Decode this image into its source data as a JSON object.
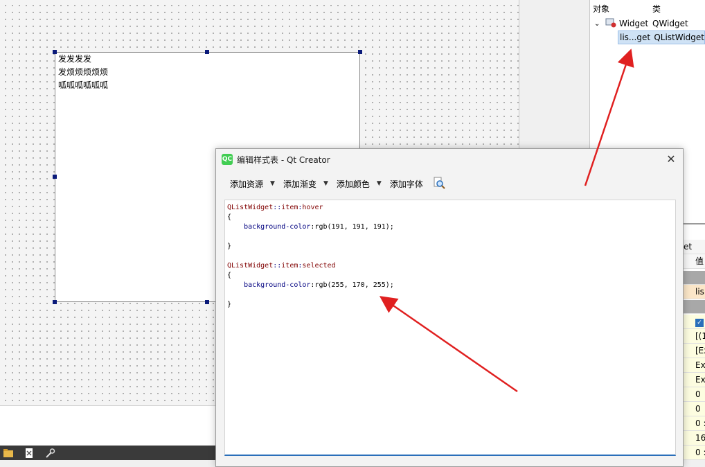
{
  "designer": {
    "list_items": [
      "发发发发",
      "发烦烦烦烦烦",
      "呱呱呱呱呱呱"
    ]
  },
  "inspector": {
    "col_object": "对象",
    "col_class": "类",
    "rows": [
      {
        "name": "Widget",
        "class": "QWidget"
      },
      {
        "name": "lis...get",
        "class": "QListWidget"
      }
    ]
  },
  "properties": {
    "header_fragment": "et",
    "value_header": "值",
    "cells": [
      "lis",
      "",
      "[(1",
      "[Ex",
      "Ex",
      "Ex",
      "0",
      "0",
      "0 :",
      "16",
      "0 :"
    ]
  },
  "dialog": {
    "title": "编辑样式表 - Qt Creator",
    "icon_text": "QC",
    "toolbar": {
      "add_resource": "添加资源",
      "add_gradient": "添加渐变",
      "add_color": "添加颜色",
      "add_font": "添加字体"
    },
    "code": [
      [
        {
          "t": "QListWidget",
          "c": "sel"
        },
        {
          "t": "::",
          "c": "op"
        },
        {
          "t": "item",
          "c": "sel"
        },
        {
          "t": ":",
          "c": "op"
        },
        {
          "t": "hover",
          "c": "sel"
        }
      ],
      [
        {
          "t": "{",
          "c": "txt"
        }
      ],
      [
        {
          "t": "    background-color",
          "c": "prop"
        },
        {
          "t": ":rgb(191, 191, 191);",
          "c": "txt"
        }
      ],
      [
        {
          "t": "",
          "c": "txt"
        }
      ],
      [
        {
          "t": "}",
          "c": "txt"
        }
      ],
      [
        {
          "t": "",
          "c": "txt"
        }
      ],
      [
        {
          "t": "QListWidget",
          "c": "sel"
        },
        {
          "t": "::",
          "c": "op"
        },
        {
          "t": "item",
          "c": "sel"
        },
        {
          "t": ":",
          "c": "op"
        },
        {
          "t": "selected",
          "c": "sel"
        }
      ],
      [
        {
          "t": "{",
          "c": "txt"
        }
      ],
      [
        {
          "t": "    background-color",
          "c": "prop"
        },
        {
          "t": ":rgb(255, 170, 255);",
          "c": "txt"
        }
      ],
      [
        {
          "t": "",
          "c": "txt"
        }
      ],
      [
        {
          "t": "}",
          "c": "txt"
        }
      ]
    ]
  },
  "colors": {
    "annotation_arrow": "#e02020",
    "accent": "#2a6fba"
  }
}
